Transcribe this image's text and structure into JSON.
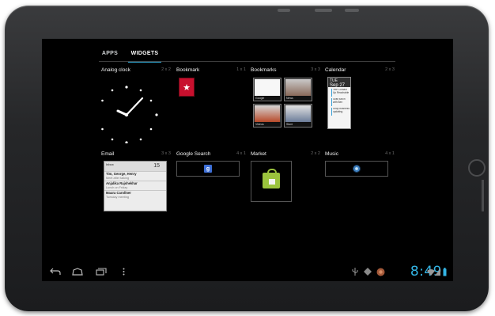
{
  "tabs": [
    {
      "label": "APPS",
      "active": false
    },
    {
      "label": "WIDGETS",
      "active": true
    }
  ],
  "widgets": [
    {
      "title": "Analog clock",
      "size": "2 x 2"
    },
    {
      "title": "Bookmark",
      "size": "1 x 1"
    },
    {
      "title": "Bookmarks",
      "size": "3 x 3"
    },
    {
      "title": "Calendar",
      "size": "2 x 3"
    },
    {
      "title": "Email",
      "size": "3 x 3"
    },
    {
      "title": "Google Search",
      "size": "4 x 1"
    },
    {
      "title": "Market",
      "size": "2 x 2"
    },
    {
      "title": "Music",
      "size": "4 x 1"
    }
  ],
  "bookmarks_preview": [
    {
      "caption": "Google"
    },
    {
      "caption": "News"
    },
    {
      "caption": "Videos"
    },
    {
      "caption": "Store"
    }
  ],
  "calendar_preview": {
    "weekday": "TUE",
    "date": "Sep 27",
    "events": [
      {
        "text": "Tele Contact Up Reachable"
      },
      {
        "text": "Grab lunch with Ben"
      },
      {
        "text": "Shop business updating"
      }
    ]
  },
  "email_preview": {
    "account": "Inbox",
    "count": "15",
    "rows": [
      {
        "from": "Tim, George, Henry",
        "subject": "Meet after talking"
      },
      {
        "from": "Anjalika Rajshekhar",
        "subject": "Lunch on Friday"
      },
      {
        "from": "Maura Carollner",
        "subject": "Tuesday meeting"
      }
    ]
  },
  "status_bar": {
    "time": "8:49"
  },
  "icons": {
    "back": "back-icon",
    "home": "home-icon",
    "recent": "recent-apps-icon",
    "menu": "menu-icon",
    "usb": "usb-icon",
    "android": "android-debug-icon",
    "notification": "notification-icon",
    "wifi": "wifi-icon",
    "battery": "battery-icon"
  },
  "colors": {
    "accent": "#33b5e5",
    "background": "#000000",
    "bookmark_red": "#c8102e",
    "market_green": "#9bc33d"
  }
}
